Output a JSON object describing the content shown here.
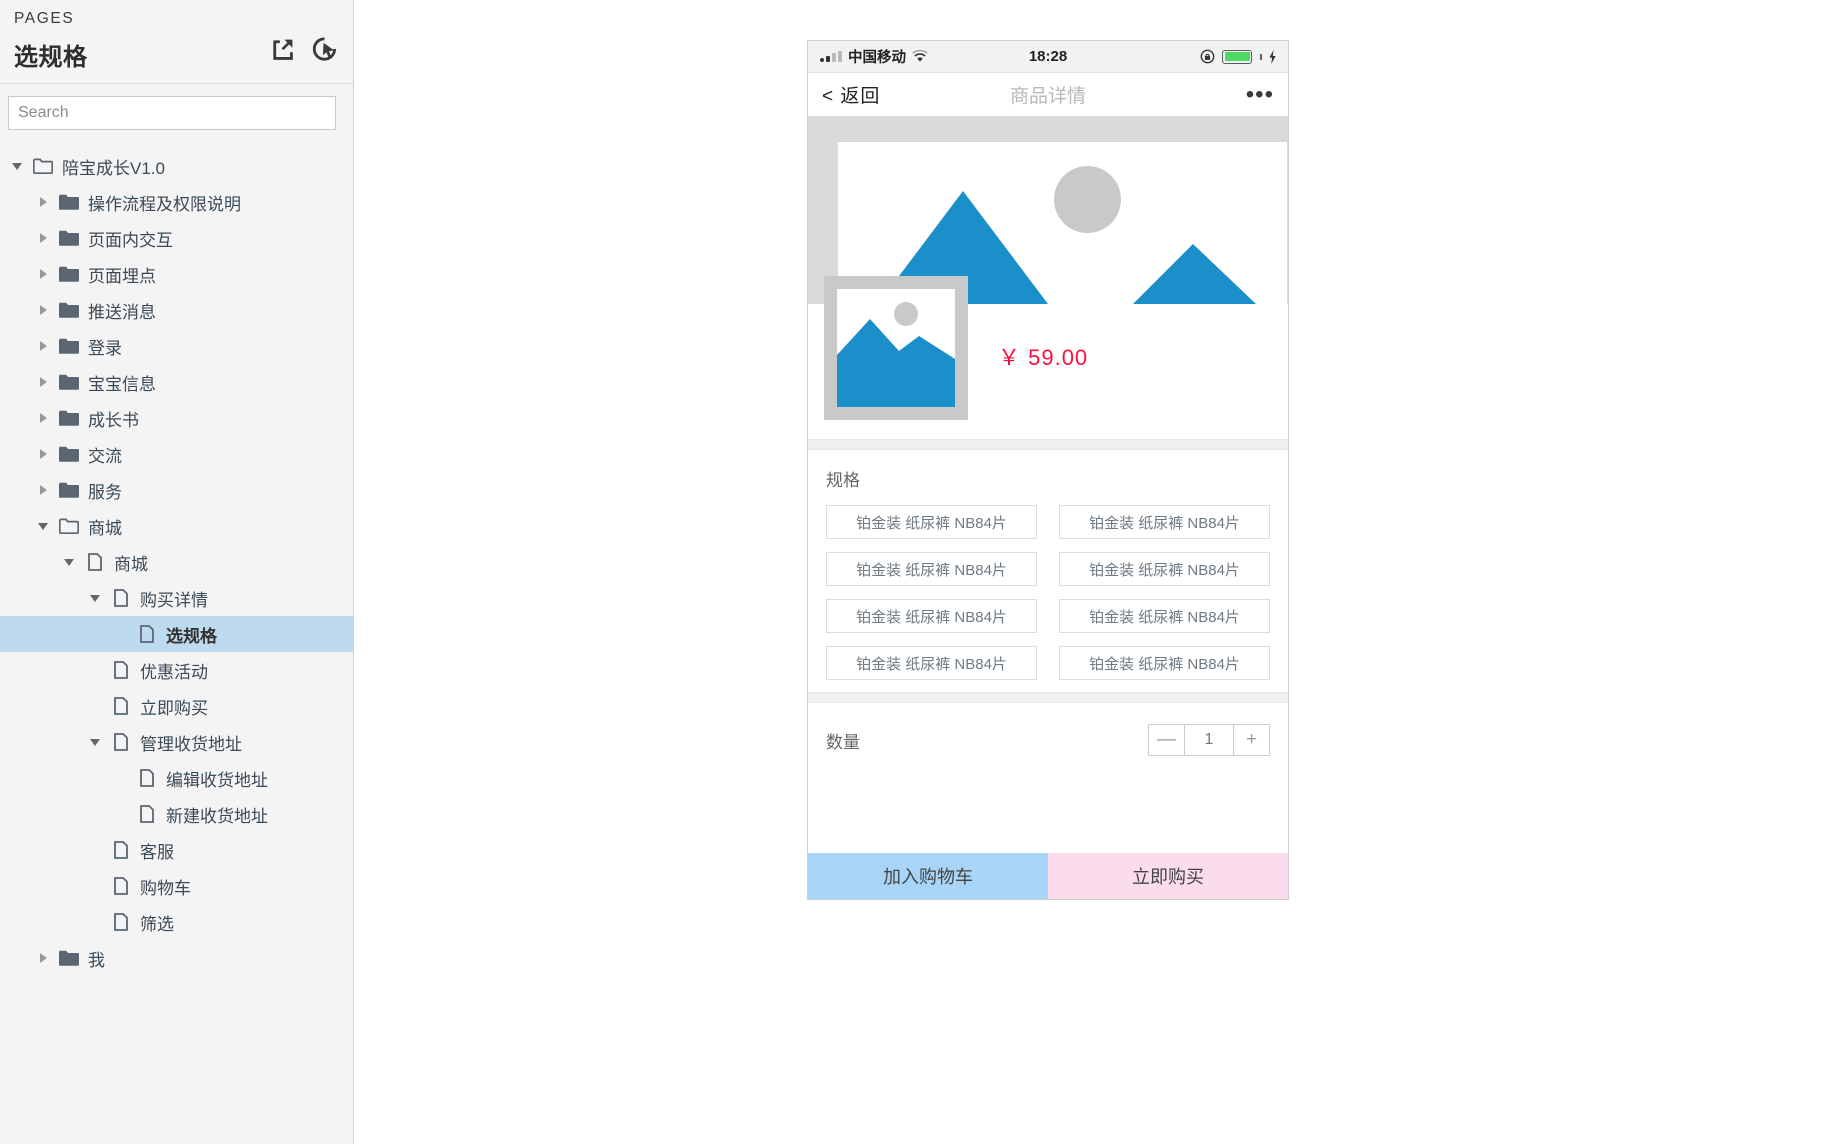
{
  "sidebar": {
    "eyebrow": "PAGES",
    "title": "选规格",
    "actions": [
      {
        "name": "export-icon",
        "label": "Export"
      },
      {
        "name": "preview-icon",
        "label": "Preview"
      }
    ],
    "search": {
      "placeholder": "Search",
      "value": ""
    },
    "tree": [
      {
        "label": "陪宝成长V1.0",
        "depth": 0,
        "type": "folder-open",
        "arrow": "down",
        "selected": false
      },
      {
        "label": "操作流程及权限说明",
        "depth": 1,
        "type": "folder",
        "arrow": "right",
        "selected": false
      },
      {
        "label": "页面内交互",
        "depth": 1,
        "type": "folder",
        "arrow": "right",
        "selected": false
      },
      {
        "label": "页面埋点",
        "depth": 1,
        "type": "folder",
        "arrow": "right",
        "selected": false
      },
      {
        "label": "推送消息",
        "depth": 1,
        "type": "folder",
        "arrow": "right",
        "selected": false
      },
      {
        "label": "登录",
        "depth": 1,
        "type": "folder",
        "arrow": "right",
        "selected": false
      },
      {
        "label": "宝宝信息",
        "depth": 1,
        "type": "folder",
        "arrow": "right",
        "selected": false
      },
      {
        "label": "成长书",
        "depth": 1,
        "type": "folder",
        "arrow": "right",
        "selected": false
      },
      {
        "label": "交流",
        "depth": 1,
        "type": "folder",
        "arrow": "right",
        "selected": false
      },
      {
        "label": "服务",
        "depth": 1,
        "type": "folder",
        "arrow": "right",
        "selected": false
      },
      {
        "label": "商城",
        "depth": 1,
        "type": "folder-open",
        "arrow": "down",
        "selected": false
      },
      {
        "label": "商城",
        "depth": 2,
        "type": "page",
        "arrow": "down",
        "selected": false
      },
      {
        "label": "购买详情",
        "depth": 3,
        "type": "page",
        "arrow": "down",
        "selected": false
      },
      {
        "label": "选规格",
        "depth": 4,
        "type": "page",
        "arrow": "none",
        "selected": true
      },
      {
        "label": "优惠活动",
        "depth": 3,
        "type": "page",
        "arrow": "none",
        "selected": false
      },
      {
        "label": "立即购买",
        "depth": 3,
        "type": "page",
        "arrow": "none",
        "selected": false
      },
      {
        "label": "管理收货地址",
        "depth": 3,
        "type": "page",
        "arrow": "down",
        "selected": false
      },
      {
        "label": "编辑收货地址",
        "depth": 4,
        "type": "page",
        "arrow": "none",
        "selected": false
      },
      {
        "label": "新建收货地址",
        "depth": 4,
        "type": "page",
        "arrow": "none",
        "selected": false
      },
      {
        "label": "客服",
        "depth": 3,
        "type": "page",
        "arrow": "none",
        "selected": false
      },
      {
        "label": "购物车",
        "depth": 3,
        "type": "page",
        "arrow": "none",
        "selected": false
      },
      {
        "label": "筛选",
        "depth": 3,
        "type": "page",
        "arrow": "none",
        "selected": false
      },
      {
        "label": "我",
        "depth": 1,
        "type": "folder",
        "arrow": "right",
        "selected": false
      }
    ]
  },
  "phone": {
    "status": {
      "carrier": "中国移动",
      "time": "18:28",
      "wifi_icon": "wifi-icon",
      "signal_icon": "signal-icon",
      "lock_icon": "rotation-lock-icon",
      "battery_icon": "battery-icon",
      "charging_icon": "charging-bolt-icon"
    },
    "navbar": {
      "back_label": "< 返回",
      "title": "商品详情",
      "more_label": "•••"
    },
    "product": {
      "price": "￥ 59.00",
      "image_placeholder_icon": "image-placeholder-icon"
    },
    "spec": {
      "title": "规格",
      "options": [
        "铂金装 纸尿裤 NB84片",
        "铂金装 纸尿裤 NB84片",
        "铂金装 纸尿裤 NB84片",
        "铂金装 纸尿裤 NB84片",
        "铂金装 纸尿裤 NB84片",
        "铂金装 纸尿裤 NB84片",
        "铂金装 纸尿裤 NB84片",
        "铂金装 纸尿裤 NB84片"
      ]
    },
    "quantity": {
      "label": "数量",
      "minus": "—",
      "value": "1",
      "plus": "+"
    },
    "footer": {
      "add_to_cart": "加入购物车",
      "buy_now": "立即购买"
    }
  },
  "colors": {
    "accent_blue": "#1b8fca",
    "price_red": "#fa1040",
    "cart_btn": "#a8d5f7",
    "buy_btn": "#fbdced",
    "selection": "#bedaef"
  }
}
